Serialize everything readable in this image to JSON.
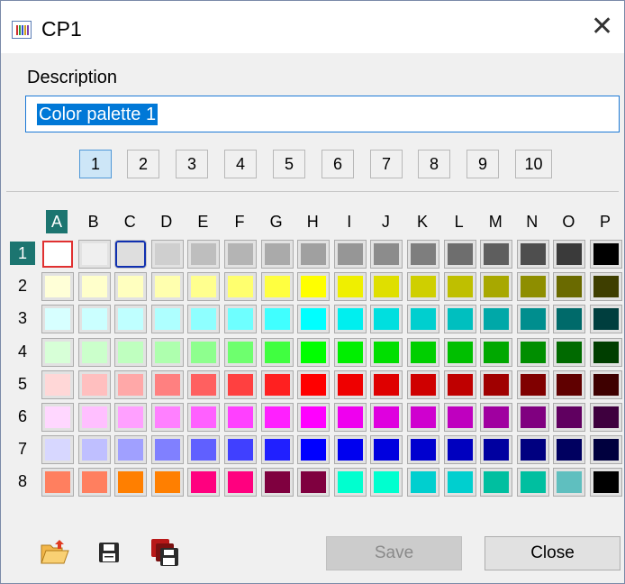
{
  "window": {
    "title": "CP1",
    "close_glyph": "✕"
  },
  "description": {
    "label": "Description",
    "value": "Color palette 1"
  },
  "pages": {
    "items": [
      "1",
      "2",
      "3",
      "4",
      "5",
      "6",
      "7",
      "8",
      "9",
      "10"
    ],
    "active_index": 0
  },
  "palette": {
    "columns": [
      "A",
      "B",
      "C",
      "D",
      "E",
      "F",
      "G",
      "H",
      "I",
      "J",
      "K",
      "L",
      "M",
      "N",
      "O",
      "P"
    ],
    "rows": [
      "1",
      "2",
      "3",
      "4",
      "5",
      "6",
      "7",
      "8"
    ],
    "active_column": "A",
    "active_row": "1",
    "selected_cell": "A1",
    "hover_cell": "C1",
    "colors": [
      [
        "#ffffff",
        "#efefef",
        "#dedede",
        "#cfcfcf",
        "#bebebe",
        "#b4b4b4",
        "#aaaaaa",
        "#a0a0a0",
        "#969696",
        "#8c8c8c",
        "#7e7e7e",
        "#6e6e6e",
        "#5e5e5e",
        "#4e4e4e",
        "#3a3a3a",
        "#000000"
      ],
      [
        "#ffffd7",
        "#ffffcb",
        "#ffffbf",
        "#ffffae",
        "#ffff8e",
        "#ffff6e",
        "#ffff40",
        "#ffff00",
        "#efef00",
        "#dfdf00",
        "#cfcf00",
        "#bfbf00",
        "#a8a800",
        "#8e8e00",
        "#6a6a00",
        "#3e3e00"
      ],
      [
        "#d7ffff",
        "#cbffff",
        "#bfffff",
        "#aeffff",
        "#8effff",
        "#6effff",
        "#40ffff",
        "#00ffff",
        "#00efef",
        "#00dfdf",
        "#00cfcf",
        "#00bfbf",
        "#00a8a8",
        "#008e8e",
        "#006a6a",
        "#003e3e"
      ],
      [
        "#d7ffd7",
        "#cbffcb",
        "#bfffbf",
        "#aeffae",
        "#8eff8e",
        "#6eff6e",
        "#40ff40",
        "#00ff00",
        "#00ef00",
        "#00df00",
        "#00cf00",
        "#00bf00",
        "#00a800",
        "#008e00",
        "#006a00",
        "#003e00"
      ],
      [
        "#ffd7d7",
        "#ffbfbf",
        "#ffa8a8",
        "#ff8080",
        "#ff6060",
        "#ff4040",
        "#ff2020",
        "#ff0000",
        "#ef0000",
        "#df0000",
        "#cf0000",
        "#bf0000",
        "#a00000",
        "#800000",
        "#600000",
        "#3e0000"
      ],
      [
        "#ffd7ff",
        "#ffbfff",
        "#ffa0ff",
        "#ff80ff",
        "#ff60ff",
        "#ff40ff",
        "#ff20ff",
        "#ff00ff",
        "#ef00ef",
        "#df00df",
        "#cf00cf",
        "#bf00bf",
        "#a000a0",
        "#800080",
        "#600060",
        "#3e003e"
      ],
      [
        "#d7d7ff",
        "#bfbfff",
        "#a0a0ff",
        "#8080ff",
        "#6060ff",
        "#4040ff",
        "#2020ff",
        "#0000ff",
        "#0000ef",
        "#0000df",
        "#0000cf",
        "#0000bf",
        "#0000a0",
        "#000080",
        "#000060",
        "#00003e"
      ],
      [
        "#ff7f5f",
        "#ff7f5f",
        "#ff7f00",
        "#ff7f00",
        "#ff007f",
        "#ff007f",
        "#7f003f",
        "#7f003f",
        "#00ffcf",
        "#00ffcf",
        "#00cfcf",
        "#00cfcf",
        "#00bfa0",
        "#00bfa0",
        "#5fbfbf",
        "#000000"
      ]
    ]
  },
  "toolbar": {
    "open_icon": "folder-open-icon",
    "save_icon": "floppy-disk-icon",
    "save_all_icon": "multiple-floppy-icon",
    "save_label": "Save",
    "close_label": "Close"
  },
  "accent": {
    "selection": "#0078d7",
    "header_active": "#1c7570",
    "cell_selected": "#e03030",
    "cell_hover": "#1030b0"
  }
}
